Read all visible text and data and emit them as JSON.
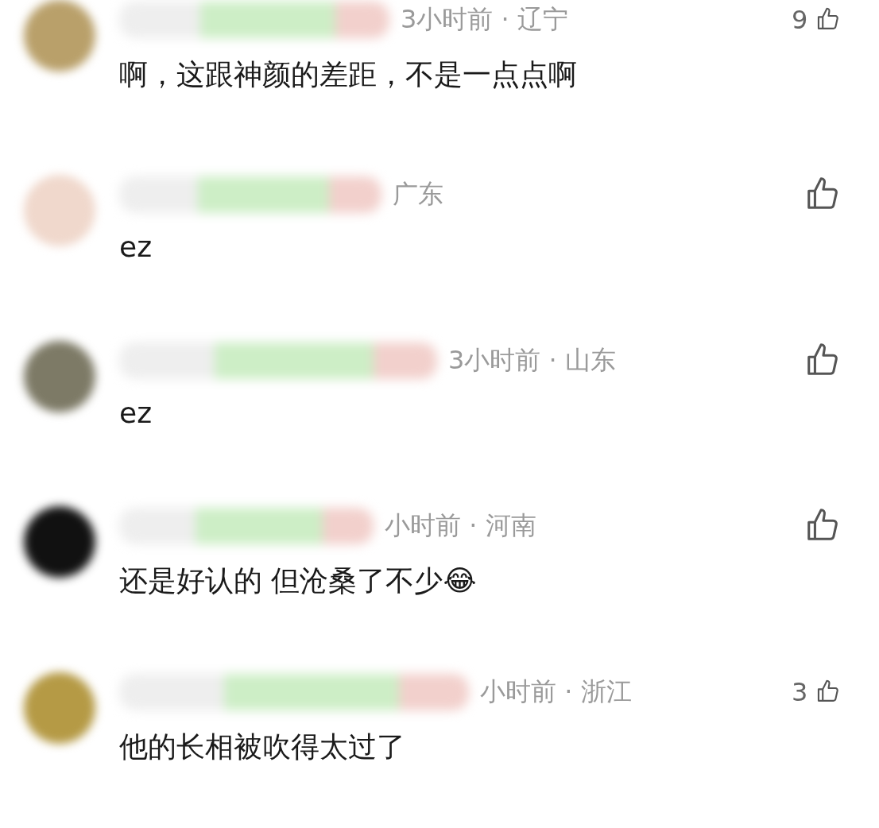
{
  "comments": [
    {
      "meta": "3小时前 · 辽宁",
      "likes": "9",
      "text": "啊，这跟神颜的差距，不是一点点啊"
    },
    {
      "meta": "广东",
      "text": "ez"
    },
    {
      "meta": "3小时前 · 山东",
      "text": "ez"
    },
    {
      "meta": "小时前 · 河南",
      "text": "还是好认的 但沧桑了不少😂"
    },
    {
      "meta": "小时前 · 浙江",
      "likes": "3",
      "text": "他的长相被吹得太过了"
    }
  ]
}
